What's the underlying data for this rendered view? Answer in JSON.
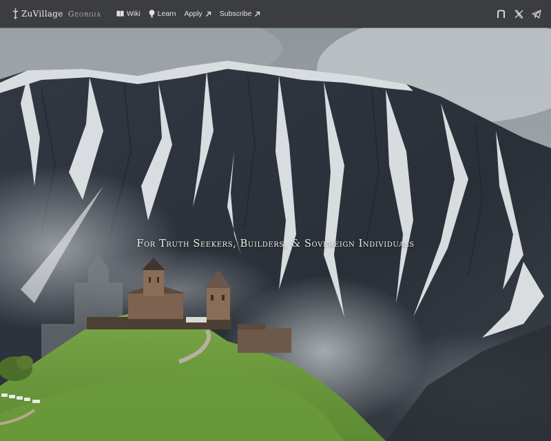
{
  "brand": {
    "name": "ZuVillage",
    "region": "Georgia",
    "logo_icon": "georgian-cross-icon"
  },
  "nav": {
    "links": [
      {
        "label": "Wiki",
        "icon": "book-icon"
      },
      {
        "label": "Learn",
        "icon": "lightbulb-icon"
      },
      {
        "label": "Apply",
        "icon": "external-arrow-icon"
      },
      {
        "label": "Subscribe",
        "icon": "external-arrow-icon"
      }
    ],
    "socials": [
      {
        "icon": "notion-icon"
      },
      {
        "icon": "x-icon"
      },
      {
        "icon": "telegram-icon"
      }
    ]
  },
  "hero": {
    "tagline": "For Truth Seekers, Builders, & Sovereign Individuals"
  },
  "colors": {
    "nav_bg": "#3c3d40",
    "text": "#e3e3e3",
    "snow": "#e8ebee",
    "rock": "#2a3038",
    "grass": "#6f9a3c"
  }
}
